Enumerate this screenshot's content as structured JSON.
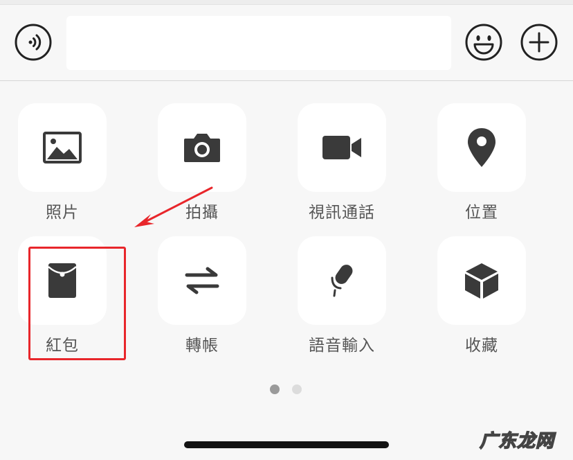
{
  "input_bar": {
    "voice_icon": "voice-input-icon",
    "message_value": "",
    "emoji_icon": "smiley-icon",
    "plus_icon": "plus-circle-icon"
  },
  "panel": {
    "items": [
      {
        "label": "照片",
        "icon": "image-icon"
      },
      {
        "label": "拍攝",
        "icon": "camera-icon"
      },
      {
        "label": "視訊通話",
        "icon": "video-call-icon"
      },
      {
        "label": "位置",
        "icon": "location-pin-icon"
      },
      {
        "label": "紅包",
        "icon": "red-envelope-icon"
      },
      {
        "label": "轉帳",
        "icon": "transfer-arrows-icon"
      },
      {
        "label": "語音輸入",
        "icon": "microphone-icon"
      },
      {
        "label": "收藏",
        "icon": "cube-icon"
      }
    ],
    "page_indicator": {
      "current": 1,
      "total": 2
    }
  },
  "annotation": {
    "highlighted_item": "紅包",
    "color": "#e8262b"
  },
  "watermark": "广东龙网",
  "colors": {
    "icon": "#3a3a3a",
    "label": "#555555",
    "background": "#f7f7f7",
    "tile": "#ffffff"
  }
}
